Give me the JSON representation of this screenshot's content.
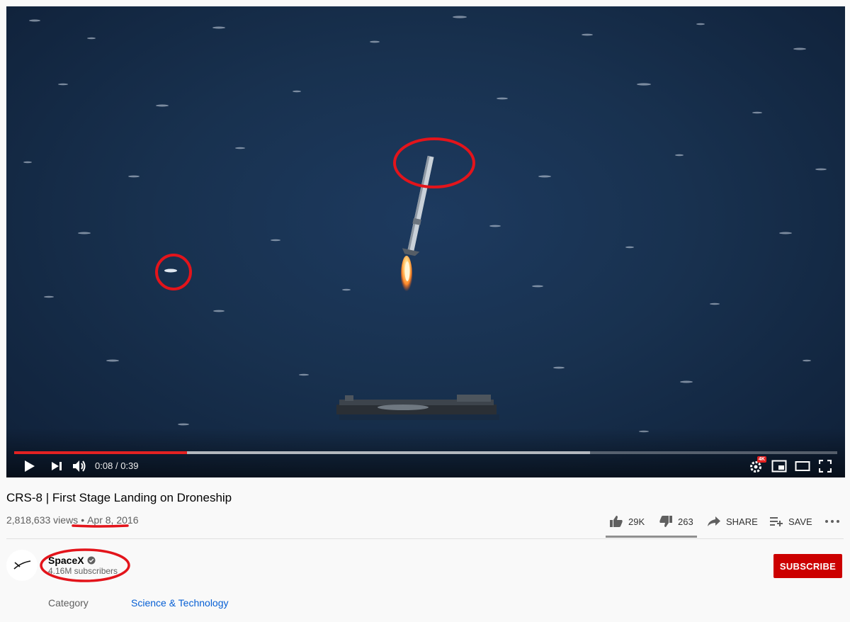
{
  "player": {
    "current_time": "0:08",
    "separator": "/",
    "duration": "0:39",
    "played_fraction": 0.21,
    "buffered_fraction": 0.7,
    "quality_badge": "4K"
  },
  "video": {
    "title": "CRS-8 | First Stage Landing on Droneship",
    "views": "2,818,633 views",
    "date": "Apr 8, 2016",
    "likes": "29K",
    "dislikes": "263",
    "share_label": "SHARE",
    "save_label": "SAVE"
  },
  "channel": {
    "name": "SpaceX",
    "subscribers": "4.16M subscribers",
    "subscribe_label": "SUBSCRIBE"
  },
  "metadata": {
    "category_label": "Category",
    "category_value": "Science & Technology"
  },
  "colors": {
    "accent_red": "#e32222",
    "subscribe_red": "#cc0000",
    "link_blue": "#065fd4",
    "annotation_red": "#e3141b"
  },
  "icons": [
    "play-icon",
    "next-icon",
    "volume-icon",
    "settings-icon",
    "miniplayer-icon",
    "theater-icon",
    "fullscreen-icon",
    "thumbs-up-icon",
    "thumbs-down-icon",
    "share-icon",
    "save-playlist-icon",
    "more-icon",
    "verified-icon",
    "spacex-logo-icon"
  ]
}
